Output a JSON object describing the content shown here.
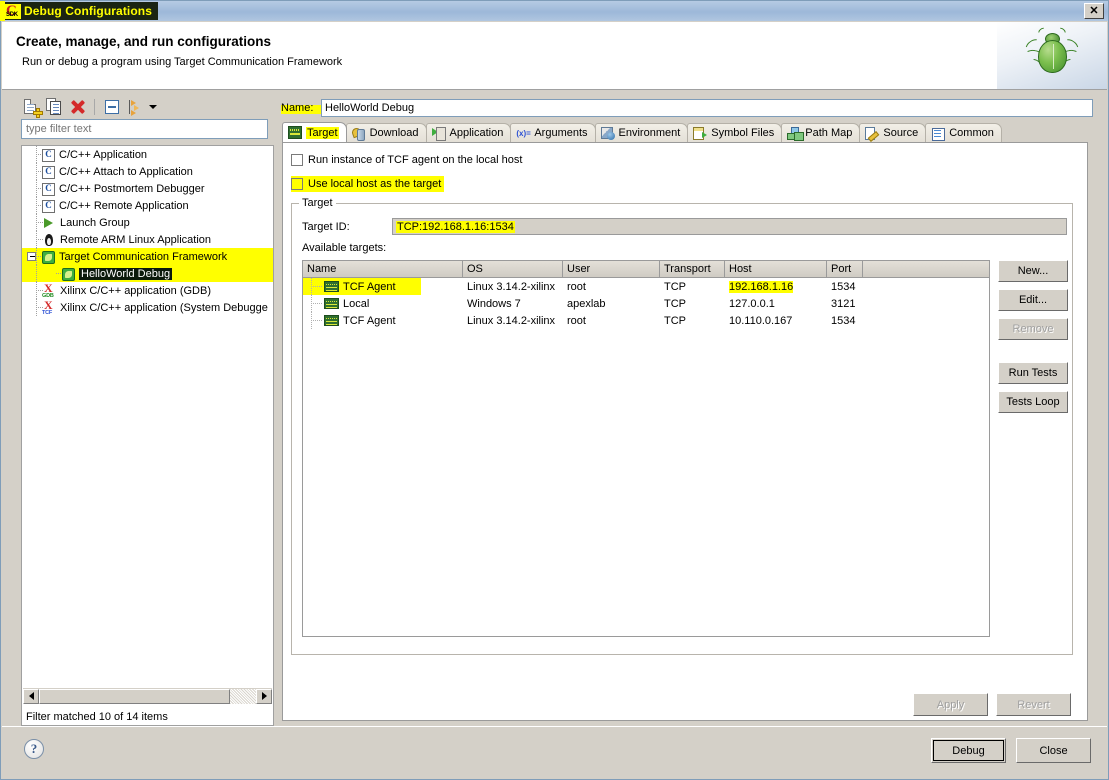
{
  "window": {
    "title": "Debug Configurations",
    "app_icon": "sdk-icon",
    "close_label": "✕"
  },
  "header": {
    "title": "Create, manage, and run configurations",
    "subtitle": "Run or debug a program using Target Communication Framework",
    "graphic": "green-bug-icon"
  },
  "left_panel": {
    "toolbar": [
      {
        "name": "new-launch-configuration",
        "icon": "new-page-icon"
      },
      {
        "name": "duplicate-launch-configuration",
        "icon": "duplicate-icon"
      },
      {
        "name": "delete-launch-configuration",
        "icon": "red-x-delete-icon"
      },
      {
        "name": "collapse-all",
        "icon": "collapse-all-icon"
      },
      {
        "name": "filter-launch-configurations",
        "icon": "filter-arrows-icon"
      },
      {
        "name": "view-menu",
        "icon": "chevron-down-icon"
      }
    ],
    "filter": {
      "placeholder": "type filter text",
      "value": ""
    },
    "tree": [
      {
        "label": "C/C++ Application",
        "icon": "c-file-icon",
        "indent": 1,
        "highlight": false,
        "selected": false,
        "expander": false
      },
      {
        "label": "C/C++ Attach to Application",
        "icon": "c-file-icon",
        "indent": 1,
        "highlight": false,
        "selected": false,
        "expander": false
      },
      {
        "label": "C/C++ Postmortem Debugger",
        "icon": "c-file-icon",
        "indent": 1,
        "highlight": false,
        "selected": false,
        "expander": false
      },
      {
        "label": "C/C++ Remote Application",
        "icon": "c-file-icon",
        "indent": 1,
        "highlight": false,
        "selected": false,
        "expander": false
      },
      {
        "label": "Launch Group",
        "icon": "play-icon",
        "indent": 1,
        "highlight": false,
        "selected": false,
        "expander": false
      },
      {
        "label": "Remote ARM Linux Application",
        "icon": "penguin-icon",
        "indent": 1,
        "highlight": false,
        "selected": false,
        "expander": false
      },
      {
        "label": "Target Communication Framework",
        "icon": "tcf-icon",
        "indent": 1,
        "highlight": true,
        "selected": false,
        "expander": true
      },
      {
        "label": "HelloWorld Debug",
        "icon": "tcf-icon",
        "indent": 2,
        "highlight": true,
        "selected": true,
        "expander": false
      },
      {
        "label": "Xilinx C/C++ application (GDB)",
        "icon": "xilinx-gdb-icon",
        "indent": 1,
        "highlight": false,
        "selected": false,
        "expander": false
      },
      {
        "label": "Xilinx C/C++ application (System Debugge",
        "icon": "xilinx-tcf-icon",
        "indent": 1,
        "highlight": false,
        "selected": false,
        "expander": false
      }
    ],
    "status": "Filter matched 10 of 14 items"
  },
  "config": {
    "name_label": "Name:",
    "name_value": "HelloWorld Debug",
    "tabs": [
      {
        "label": "Target",
        "icon": "target-board-icon",
        "active": true
      },
      {
        "label": "Download",
        "icon": "download-pin-icon",
        "active": false
      },
      {
        "label": "Application",
        "icon": "application-icon",
        "active": false
      },
      {
        "label": "Arguments",
        "icon": "arguments-icon",
        "active": false
      },
      {
        "label": "Environment",
        "icon": "environment-icon",
        "active": false
      },
      {
        "label": "Symbol Files",
        "icon": "symbol-files-icon",
        "active": false
      },
      {
        "label": "Path Map",
        "icon": "path-map-icon",
        "active": false
      },
      {
        "label": "Source",
        "icon": "source-icon",
        "active": false
      },
      {
        "label": "Common",
        "icon": "common-icon",
        "active": false
      }
    ],
    "checkboxes": [
      {
        "label": "Run instance of TCF agent on the local host",
        "checked": false,
        "highlight": false
      },
      {
        "label": "Use local host as the target",
        "checked": false,
        "highlight": true
      }
    ],
    "target_group": {
      "legend": "Target",
      "target_id_label": "Target ID:",
      "target_id_value": "TCP:192.168.1.16:1534",
      "available_label": "Available targets:",
      "columns": [
        "Name",
        "OS",
        "User",
        "Transport",
        "Host",
        "Port"
      ],
      "rows": [
        {
          "name": "TCF Agent",
          "os": "Linux 3.14.2-xilinx",
          "user": "root",
          "transport": "TCP",
          "host": "192.168.1.16",
          "port": "1534",
          "name_highlight": true,
          "host_highlight": true
        },
        {
          "name": "Local",
          "os": "Windows 7",
          "user": "apexlab",
          "transport": "TCP",
          "host": "127.0.0.1",
          "port": "3121",
          "name_highlight": false,
          "host_highlight": false
        },
        {
          "name": "TCF Agent",
          "os": "Linux 3.14.2-xilinx",
          "user": "root",
          "transport": "TCP",
          "host": "10.110.0.167",
          "port": "1534",
          "name_highlight": false,
          "host_highlight": false
        }
      ],
      "buttons": [
        {
          "label": "New...",
          "enabled": true
        },
        {
          "label": "Edit...",
          "enabled": true
        },
        {
          "label": "Remove",
          "enabled": false
        },
        {
          "label": "Run Tests",
          "enabled": true
        },
        {
          "label": "Tests Loop",
          "enabled": true
        }
      ]
    },
    "apply_label": "Apply",
    "revert_label": "Revert",
    "apply_enabled": false,
    "revert_enabled": false
  },
  "footer": {
    "help_glyph": "?",
    "debug_label": "Debug",
    "close_label": "Close"
  },
  "colors": {
    "highlight": "#ffff00",
    "dialog_bg": "#d4d0c8",
    "titlebar_text": "#ffff00",
    "selection_bg": "#0c1a0c"
  }
}
